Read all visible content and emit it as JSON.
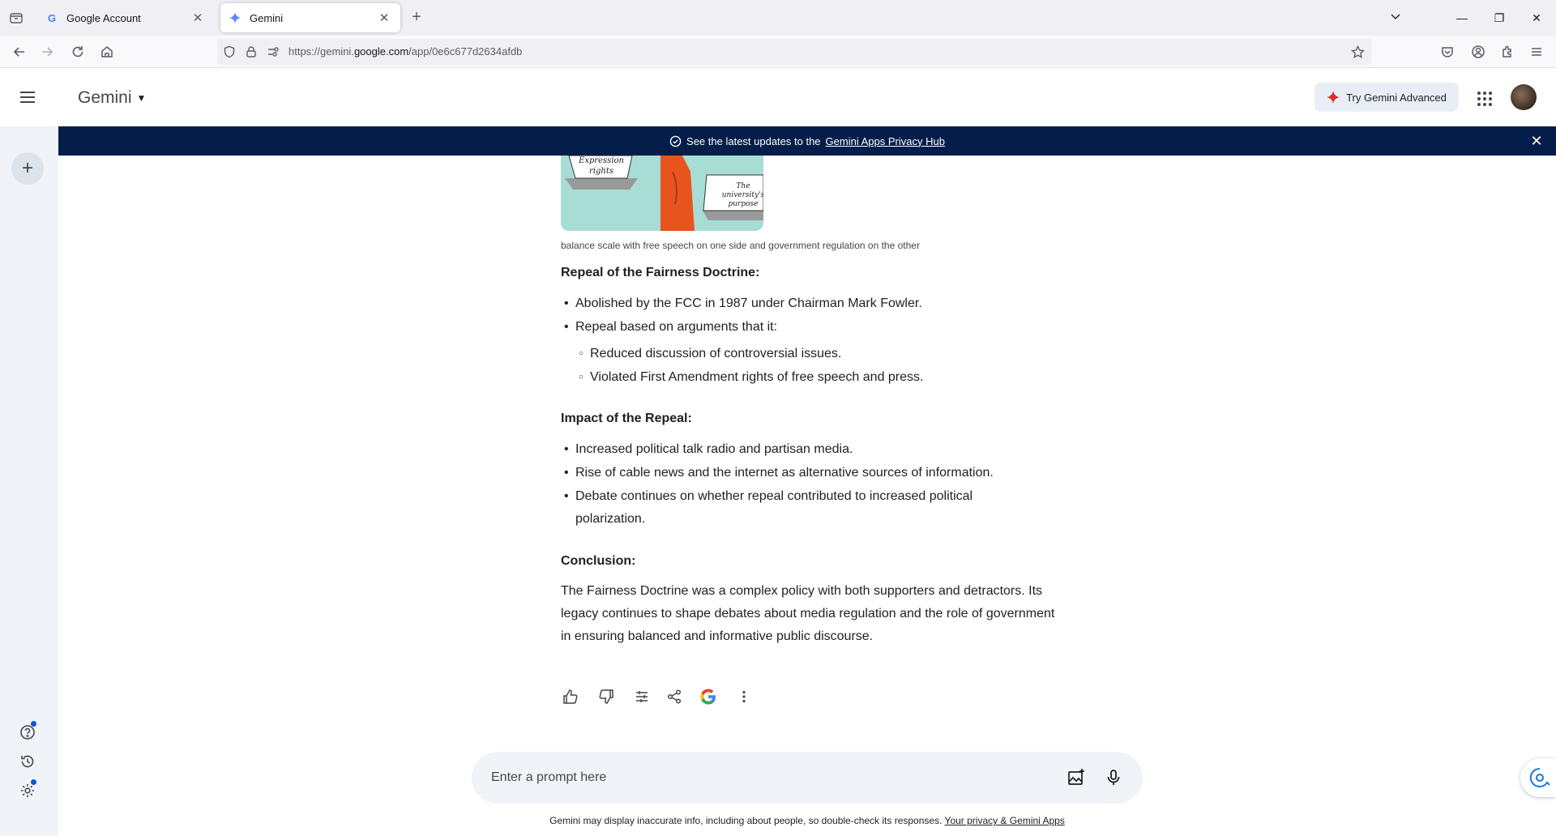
{
  "browser": {
    "tabs": [
      {
        "label": "Google Account",
        "favicon": "G"
      },
      {
        "label": "Gemini",
        "favicon": "gemini-star"
      }
    ],
    "url_prefix": "https://gemini.",
    "url_host": "google.com",
    "url_path": "/app/0e6c677d2634afdb"
  },
  "header": {
    "title": "Gemini",
    "try_advanced": "Try Gemini Advanced"
  },
  "banner": {
    "text": "See the latest updates to the",
    "link": "Gemini Apps Privacy Hub"
  },
  "illustration": {
    "left_label_1": "Expression",
    "left_label_2": "rights",
    "right_label_1": "The",
    "right_label_2": "university's",
    "right_label_3": "purpose"
  },
  "content": {
    "caption": "balance scale with free speech on one side and government regulation on the other",
    "section1": {
      "heading": "Repeal of the Fairness Doctrine:",
      "bullet1": "Abolished by the FCC in 1987 under Chairman Mark Fowler.",
      "bullet2": "Repeal based on arguments that it:",
      "sub1": "Reduced discussion of controversial issues.",
      "sub2": "Violated First Amendment rights of free speech and press."
    },
    "section2": {
      "heading": "Impact of the Repeal:",
      "bullet1": "Increased political talk radio and partisan media.",
      "bullet2": "Rise of cable news and the internet as alternative sources of information.",
      "bullet3": "Debate continues on whether repeal contributed to increased political polarization."
    },
    "section3": {
      "heading": "Conclusion:",
      "paragraph": "The Fairness Doctrine was a complex policy with both supporters and detractors. Its legacy continues to shape debates about media regulation and the role of government in ensuring balanced and informative public discourse."
    }
  },
  "prompt": {
    "placeholder": "Enter a prompt here"
  },
  "footer": {
    "disclaimer": "Gemini may display inaccurate info, including about people, so double-check its responses.",
    "link": "Your privacy & Gemini Apps"
  },
  "colors": {
    "banner_bg": "#041e49",
    "sidebar_bg": "#f0f4f9",
    "accent": "#0b57d0"
  }
}
